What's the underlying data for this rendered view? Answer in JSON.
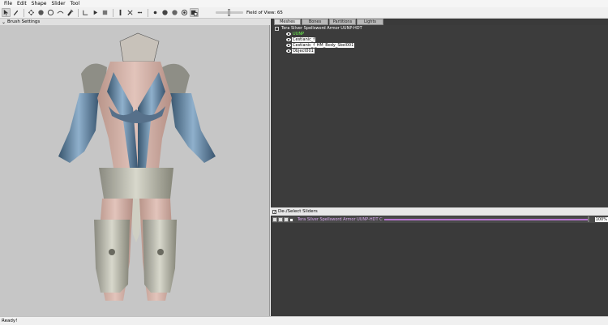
{
  "menu": [
    "File",
    "Edit",
    "Shape",
    "Slider",
    "Tool"
  ],
  "toolbar": {
    "buttons": [
      "select-icon",
      "brush-icon",
      "move-icon",
      "inflate-icon",
      "deflate-icon",
      "smooth-icon",
      "undo-icon",
      "redo-icon",
      "pick-icon",
      "mirror-icon",
      "vertex-icon",
      "axis-icon",
      "light-icon",
      "wire-icon",
      "shade-icon",
      "texture-icon",
      "color-icon"
    ],
    "fov_label": "Field of View: 65"
  },
  "viewport": {
    "brush_settings": "Brush Settings",
    "model": "armored-figure-render"
  },
  "tabs": [
    "Meshes",
    "Bones",
    "Partitions",
    "Lights"
  ],
  "tree": {
    "root": "Tera Silver Spellsword Armor UUNP-HDT",
    "items": [
      {
        "label": "UUNP",
        "style": "green"
      },
      {
        "label": "Cestianic_f",
        "style": "hl"
      },
      {
        "label": "Cestianic_f_HM_Body_Skel001",
        "style": "hl"
      },
      {
        "label": "Object001",
        "style": "hl"
      }
    ]
  },
  "sliders": {
    "header": "De-/Select Sliders",
    "row_name": "Tera Silver Spellsword Armor UUNP-HDT Conversi",
    "row_value": "100%",
    "row_level": 100,
    "colors": {
      "track": "#b673d0",
      "label": "#d8a6ef"
    }
  },
  "status": "Ready!"
}
